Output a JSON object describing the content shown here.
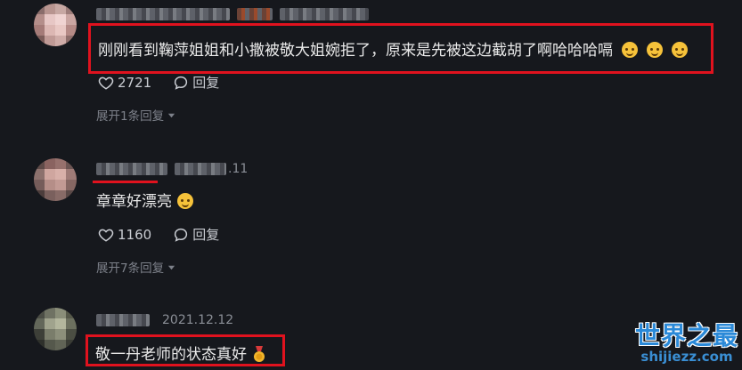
{
  "comments": [
    {
      "text": "刚刚看到鞠萍姐姐和小撒被敬大姐婉拒了，原来是先被这边截胡了啊哈哈哈嗝",
      "emojis": [
        "grinning-squint-icon",
        "grinning-squint-icon",
        "grinning-squint-icon"
      ],
      "likes": "2721",
      "reply_label": "回复",
      "expand_label": "展开1条回复"
    },
    {
      "time": ".11",
      "text": "章章好漂亮",
      "emojis": [
        "heart-eyes-icon"
      ],
      "likes": "1160",
      "reply_label": "回复",
      "expand_label": "展开7条回复"
    },
    {
      "time": "2021.12.12",
      "text": "敬一丹老师的状态真好",
      "emojis": [
        "medal-icon"
      ]
    }
  ],
  "watermark": {
    "main": "世界之最",
    "sub": "shijiezz.com"
  },
  "colors": {
    "background": "#16181d",
    "highlight": "#e0121e",
    "watermark": "#2a89d8"
  }
}
